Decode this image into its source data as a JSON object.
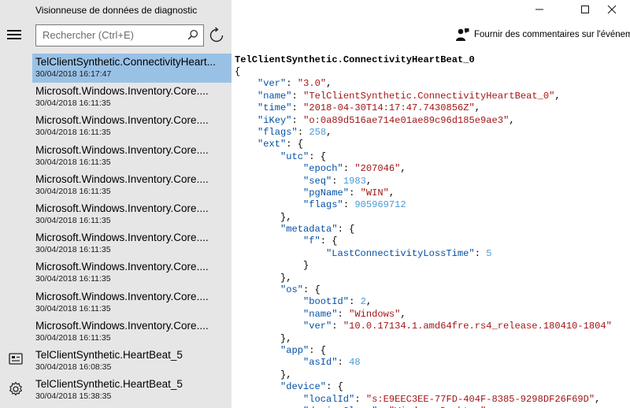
{
  "app": {
    "title": "Visionneuse de données de diagnostic"
  },
  "search": {
    "placeholder": "Rechercher (Ctrl+E)",
    "value": ""
  },
  "toolbar": {
    "feedback_label": "Fournir des commentaires sur l'événement"
  },
  "events": [
    {
      "name": "TelClientSynthetic.ConnectivityHeartBeat_0",
      "display": "TelClientSynthetic.ConnectivityHeart...",
      "time": "30/04/2018 16:17:47",
      "selected": true
    },
    {
      "name": "Microsoft.Windows.Inventory.Core...",
      "display": "Microsoft.Windows.Inventory.Core....",
      "time": "30/04/2018 16:11:35"
    },
    {
      "name": "Microsoft.Windows.Inventory.Core...",
      "display": "Microsoft.Windows.Inventory.Core....",
      "time": "30/04/2018 16:11:35"
    },
    {
      "name": "Microsoft.Windows.Inventory.Core...",
      "display": "Microsoft.Windows.Inventory.Core....",
      "time": "30/04/2018 16:11:35"
    },
    {
      "name": "Microsoft.Windows.Inventory.Core...",
      "display": "Microsoft.Windows.Inventory.Core....",
      "time": "30/04/2018 16:11:35"
    },
    {
      "name": "Microsoft.Windows.Inventory.Core...",
      "display": "Microsoft.Windows.Inventory.Core....",
      "time": "30/04/2018 16:11:35"
    },
    {
      "name": "Microsoft.Windows.Inventory.Core...",
      "display": "Microsoft.Windows.Inventory.Core....",
      "time": "30/04/2018 16:11:35"
    },
    {
      "name": "Microsoft.Windows.Inventory.Core...",
      "display": "Microsoft.Windows.Inventory.Core....",
      "time": "30/04/2018 16:11:35"
    },
    {
      "name": "Microsoft.Windows.Inventory.Core...",
      "display": "Microsoft.Windows.Inventory.Core....",
      "time": "30/04/2018 16:11:35"
    },
    {
      "name": "Microsoft.Windows.Inventory.Core...",
      "display": "Microsoft.Windows.Inventory.Core....",
      "time": "30/04/2018 16:11:35"
    },
    {
      "name": "TelClientSynthetic.HeartBeat_5",
      "display": "TelClientSynthetic.HeartBeat_5",
      "time": "30/04/2018 16:08:35"
    },
    {
      "name": "TelClientSynthetic.HeartBeat_5",
      "display": "TelClientSynthetic.HeartBeat_5",
      "time": "30/04/2018 15:38:35"
    }
  ],
  "detail": {
    "title": "TelClientSynthetic.ConnectivityHeartBeat_0",
    "lines": [
      {
        "indent": 0,
        "parts": [
          {
            "t": "p",
            "v": "{"
          }
        ]
      },
      {
        "indent": 1,
        "parts": [
          {
            "t": "k",
            "v": "\"ver\""
          },
          {
            "t": "p",
            "v": ": "
          },
          {
            "t": "s",
            "v": "\"3.0\""
          },
          {
            "t": "p",
            "v": ","
          }
        ]
      },
      {
        "indent": 1,
        "parts": [
          {
            "t": "k",
            "v": "\"name\""
          },
          {
            "t": "p",
            "v": ": "
          },
          {
            "t": "s",
            "v": "\"TelClientSynthetic.ConnectivityHeartBeat_0\""
          },
          {
            "t": "p",
            "v": ","
          }
        ]
      },
      {
        "indent": 1,
        "parts": [
          {
            "t": "k",
            "v": "\"time\""
          },
          {
            "t": "p",
            "v": ": "
          },
          {
            "t": "s",
            "v": "\"2018-04-30T14:17:47.7430856Z\""
          },
          {
            "t": "p",
            "v": ","
          }
        ]
      },
      {
        "indent": 1,
        "parts": [
          {
            "t": "k",
            "v": "\"iKey\""
          },
          {
            "t": "p",
            "v": ": "
          },
          {
            "t": "s",
            "v": "\"o:0a89d516ae714e01ae89c96d185e9ae3\""
          },
          {
            "t": "p",
            "v": ","
          }
        ]
      },
      {
        "indent": 1,
        "parts": [
          {
            "t": "k",
            "v": "\"flags\""
          },
          {
            "t": "p",
            "v": ": "
          },
          {
            "t": "n",
            "v": "258"
          },
          {
            "t": "p",
            "v": ","
          }
        ]
      },
      {
        "indent": 1,
        "parts": [
          {
            "t": "k",
            "v": "\"ext\""
          },
          {
            "t": "p",
            "v": ": {"
          }
        ]
      },
      {
        "indent": 2,
        "parts": [
          {
            "t": "k",
            "v": "\"utc\""
          },
          {
            "t": "p",
            "v": ": {"
          }
        ]
      },
      {
        "indent": 3,
        "parts": [
          {
            "t": "k",
            "v": "\"epoch\""
          },
          {
            "t": "p",
            "v": ": "
          },
          {
            "t": "s",
            "v": "\"207046\""
          },
          {
            "t": "p",
            "v": ","
          }
        ]
      },
      {
        "indent": 3,
        "parts": [
          {
            "t": "k",
            "v": "\"seq\""
          },
          {
            "t": "p",
            "v": ": "
          },
          {
            "t": "n",
            "v": "1983"
          },
          {
            "t": "p",
            "v": ","
          }
        ]
      },
      {
        "indent": 3,
        "parts": [
          {
            "t": "k",
            "v": "\"pgName\""
          },
          {
            "t": "p",
            "v": ": "
          },
          {
            "t": "s",
            "v": "\"WIN\""
          },
          {
            "t": "p",
            "v": ","
          }
        ]
      },
      {
        "indent": 3,
        "parts": [
          {
            "t": "k",
            "v": "\"flags\""
          },
          {
            "t": "p",
            "v": ": "
          },
          {
            "t": "n",
            "v": "905969712"
          }
        ]
      },
      {
        "indent": 2,
        "parts": [
          {
            "t": "p",
            "v": "},"
          }
        ]
      },
      {
        "indent": 2,
        "parts": [
          {
            "t": "k",
            "v": "\"metadata\""
          },
          {
            "t": "p",
            "v": ": {"
          }
        ]
      },
      {
        "indent": 3,
        "parts": [
          {
            "t": "k",
            "v": "\"f\""
          },
          {
            "t": "p",
            "v": ": {"
          }
        ]
      },
      {
        "indent": 4,
        "parts": [
          {
            "t": "k",
            "v": "\"LastConnectivityLossTime\""
          },
          {
            "t": "p",
            "v": ": "
          },
          {
            "t": "n",
            "v": "5"
          }
        ]
      },
      {
        "indent": 3,
        "parts": [
          {
            "t": "p",
            "v": "}"
          }
        ]
      },
      {
        "indent": 2,
        "parts": [
          {
            "t": "p",
            "v": "},"
          }
        ]
      },
      {
        "indent": 2,
        "parts": [
          {
            "t": "k",
            "v": "\"os\""
          },
          {
            "t": "p",
            "v": ": {"
          }
        ]
      },
      {
        "indent": 3,
        "parts": [
          {
            "t": "k",
            "v": "\"bootId\""
          },
          {
            "t": "p",
            "v": ": "
          },
          {
            "t": "n",
            "v": "2"
          },
          {
            "t": "p",
            "v": ","
          }
        ]
      },
      {
        "indent": 3,
        "parts": [
          {
            "t": "k",
            "v": "\"name\""
          },
          {
            "t": "p",
            "v": ": "
          },
          {
            "t": "s",
            "v": "\"Windows\""
          },
          {
            "t": "p",
            "v": ","
          }
        ]
      },
      {
        "indent": 3,
        "parts": [
          {
            "t": "k",
            "v": "\"ver\""
          },
          {
            "t": "p",
            "v": ": "
          },
          {
            "t": "s",
            "v": "\"10.0.17134.1.amd64fre.rs4_release.180410-1804\""
          }
        ]
      },
      {
        "indent": 2,
        "parts": [
          {
            "t": "p",
            "v": "},"
          }
        ]
      },
      {
        "indent": 2,
        "parts": [
          {
            "t": "k",
            "v": "\"app\""
          },
          {
            "t": "p",
            "v": ": {"
          }
        ]
      },
      {
        "indent": 3,
        "parts": [
          {
            "t": "k",
            "v": "\"asId\""
          },
          {
            "t": "p",
            "v": ": "
          },
          {
            "t": "n",
            "v": "48"
          }
        ]
      },
      {
        "indent": 2,
        "parts": [
          {
            "t": "p",
            "v": "},"
          }
        ]
      },
      {
        "indent": 2,
        "parts": [
          {
            "t": "k",
            "v": "\"device\""
          },
          {
            "t": "p",
            "v": ": {"
          }
        ]
      },
      {
        "indent": 3,
        "parts": [
          {
            "t": "k",
            "v": "\"localId\""
          },
          {
            "t": "p",
            "v": ": "
          },
          {
            "t": "s",
            "v": "\"s:E9EEC3EE-77FD-404F-8385-9298DF26F69D\""
          },
          {
            "t": "p",
            "v": ","
          }
        ]
      },
      {
        "indent": 3,
        "parts": [
          {
            "t": "k",
            "v": "\"deviceClass\""
          },
          {
            "t": "p",
            "v": ": "
          },
          {
            "t": "s",
            "v": "\"Windows.Desktop\""
          }
        ]
      }
    ]
  },
  "icons": {
    "menu": "hamburger-menu-icon",
    "search": "search-icon",
    "refresh": "refresh-icon",
    "feedback": "feedback-person-icon",
    "diagnostics": "diagnostic-data-icon",
    "settings": "gear-icon",
    "minimize": "minimize-icon",
    "maximize": "maximize-icon",
    "close": "close-icon"
  },
  "colors": {
    "selection": "#99c1e6",
    "sidebar_bg": "#e6e6e6",
    "json_key": "#0451a5",
    "json_string": "#a31515",
    "json_number": "#4a9bd6"
  }
}
